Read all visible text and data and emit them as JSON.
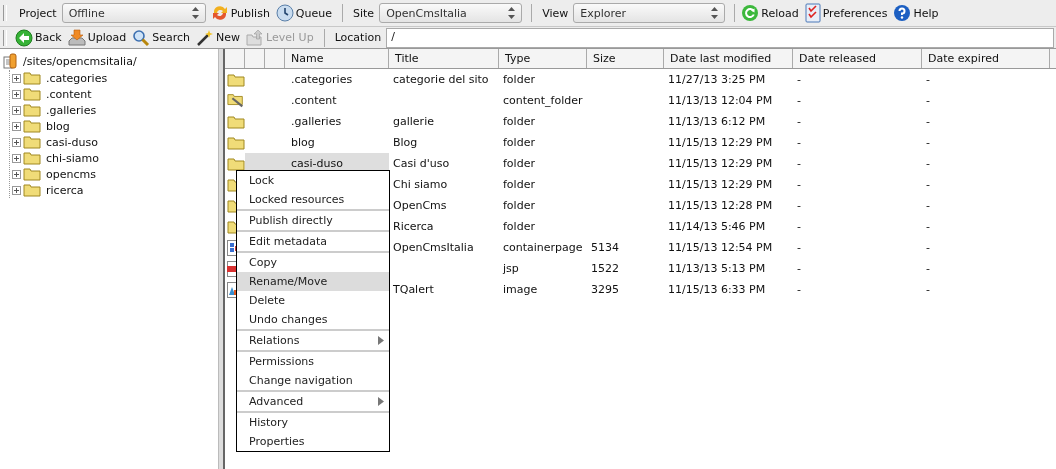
{
  "toolbars": [
    {
      "items": [
        {
          "kind": "label",
          "text": "Project"
        },
        {
          "kind": "select",
          "value": "Offline"
        },
        {
          "kind": "button",
          "label": "Publish",
          "disabled": false
        },
        {
          "kind": "button",
          "label": "Queue",
          "disabled": false
        },
        {
          "kind": "separator"
        },
        {
          "kind": "label",
          "text": "Site"
        },
        {
          "kind": "select",
          "value": "OpenCmsItalia"
        },
        {
          "kind": "separator"
        },
        {
          "kind": "label",
          "text": "View"
        },
        {
          "kind": "select",
          "value": "Explorer"
        },
        {
          "kind": "separator"
        },
        {
          "kind": "button",
          "label": "Reload",
          "disabled": false
        },
        {
          "kind": "button",
          "label": "Preferences",
          "disabled": false
        },
        {
          "kind": "button",
          "label": "Help",
          "disabled": false
        }
      ]
    },
    {
      "items": [
        {
          "kind": "button",
          "label": "Back",
          "disabled": false
        },
        {
          "kind": "button",
          "label": "Upload",
          "disabled": false
        },
        {
          "kind": "button",
          "label": "Search",
          "disabled": false
        },
        {
          "kind": "button",
          "label": "New",
          "disabled": false
        },
        {
          "kind": "button",
          "label": "Level Up",
          "disabled": true
        },
        {
          "kind": "separator"
        },
        {
          "kind": "label",
          "text": "Location"
        },
        {
          "kind": "field",
          "value": "/"
        }
      ]
    }
  ],
  "tree": {
    "root": "/sites/opencmsitalia/",
    "children": [
      {
        "label": ".categories",
        "expanded": false
      },
      {
        "label": ".content",
        "expanded": false
      },
      {
        "label": ".galleries",
        "expanded": false
      },
      {
        "label": "blog",
        "expanded": false
      },
      {
        "label": "casi-duso",
        "expanded": false
      },
      {
        "label": "chi-siamo",
        "expanded": false
      },
      {
        "label": "opencms",
        "expanded": false
      },
      {
        "label": "ricerca",
        "expanded": false
      }
    ]
  },
  "table": {
    "columns": [
      "Name",
      "Title",
      "Type",
      "Size",
      "Date last modified",
      "Date released",
      "Date expired"
    ],
    "rows": [
      {
        "kind": "dir",
        "selected": false,
        "name": ".categories",
        "title": "categorie del sito",
        "type": "folder",
        "modified": "11/27/13 3:25 PM",
        "released": "-",
        "expired": "-"
      },
      {
        "kind": "tool_dir",
        "selected": false,
        "name": ".content",
        "type": "content_folder",
        "modified": "11/13/13 12:04 PM",
        "released": "-",
        "expired": "-"
      },
      {
        "kind": "dir",
        "selected": false,
        "name": ".galleries",
        "title": "gallerie",
        "type": "folder",
        "modified": "11/13/13 6:12 PM",
        "released": "-",
        "expired": "-"
      },
      {
        "kind": "dir",
        "selected": false,
        "name": "blog",
        "title": "Blog",
        "type": "folder",
        "modified": "11/15/13 12:29 PM",
        "released": "-",
        "expired": "-"
      },
      {
        "kind": "dir",
        "selected": true,
        "name": "casi-duso",
        "title": "Casi d'uso",
        "type": "folder",
        "modified": "11/15/13 12:29 PM",
        "released": "-",
        "expired": "-"
      },
      {
        "kind": "dir",
        "title": "Chi siamo",
        "type": "folder",
        "modified": "11/15/13 12:29 PM",
        "released": "-",
        "expired": "-"
      },
      {
        "kind": "dir",
        "title": "OpenCms",
        "type": "folder",
        "modified": "11/15/13 12:28 PM",
        "released": "-",
        "expired": "-"
      },
      {
        "kind": "dir",
        "title": "Ricerca",
        "type": "folder",
        "modified": "11/14/13 5:46 PM",
        "released": "-",
        "expired": "-"
      },
      {
        "kind": "layout",
        "title": "OpenCmsItalia",
        "type": "containerpage",
        "size": "5134",
        "modified": "11/15/13 12:54 PM",
        "released": "-",
        "expired": "-"
      },
      {
        "kind": "script",
        "type": "jsp",
        "size": "1522",
        "modified": "11/13/13 5:13 PM",
        "released": "-",
        "expired": "-"
      },
      {
        "kind": "graphic",
        "title": "TQalert",
        "type": "image",
        "size": "3295",
        "modified": "11/15/13 6:33 PM",
        "released": "-",
        "expired": "-"
      }
    ]
  },
  "context_menu": {
    "groups": [
      [
        {
          "label": "Lock",
          "submenu": false,
          "selected": false
        },
        {
          "label": "Locked resources",
          "submenu": false,
          "selected": false
        }
      ],
      [
        {
          "label": "Publish directly",
          "submenu": false,
          "selected": false
        }
      ],
      [
        {
          "label": "Edit metadata",
          "submenu": false,
          "selected": false
        }
      ],
      [
        {
          "label": "Copy",
          "submenu": false,
          "selected": false
        },
        {
          "label": "Rename/Move",
          "submenu": false,
          "selected": true
        },
        {
          "label": "Delete",
          "submenu": false,
          "selected": false
        },
        {
          "label": "Undo changes",
          "submenu": false,
          "selected": false
        }
      ],
      [
        {
          "label": "Relations",
          "submenu": true,
          "selected": false
        }
      ],
      [
        {
          "label": "Permissions",
          "submenu": false,
          "selected": false
        },
        {
          "label": "Change navigation",
          "submenu": false,
          "selected": false
        }
      ],
      [
        {
          "label": "Advanced",
          "submenu": true,
          "selected": false
        }
      ],
      [
        {
          "label": "History",
          "submenu": false,
          "selected": false
        },
        {
          "label": "Properties",
          "submenu": false,
          "selected": false
        }
      ]
    ]
  }
}
